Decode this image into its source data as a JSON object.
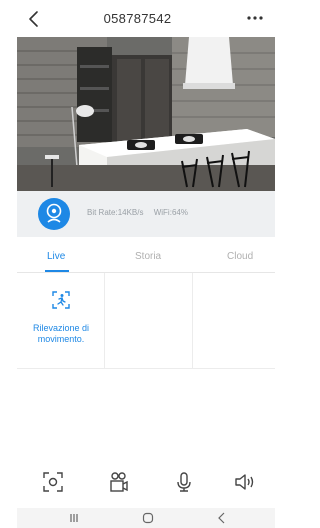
{
  "header": {
    "title": "058787542",
    "back_icon": "chevron-left-icon",
    "more_icon": "more-horizontal-icon"
  },
  "video": {
    "description_icon": "camera-feed"
  },
  "status": {
    "bitrate_label": "Bit Rate:",
    "bitrate_value": "14KB/s",
    "wifi_label": "WiFi:",
    "wifi_value": "64%",
    "camera_color": "#1e88e5"
  },
  "tabs": [
    {
      "label": "Live",
      "active": true
    },
    {
      "label": "Storia",
      "active": false
    },
    {
      "label": "Cloud",
      "active": false
    }
  ],
  "features": [
    {
      "label": "Rilevazione di movimento.",
      "icon": "motion-detection-icon"
    }
  ],
  "toolbar": [
    {
      "icon": "screenshot-icon"
    },
    {
      "icon": "video-record-icon"
    },
    {
      "icon": "microphone-icon"
    },
    {
      "icon": "speaker-icon"
    }
  ],
  "system_nav": [
    {
      "icon": "recent-apps-icon"
    },
    {
      "icon": "home-icon"
    },
    {
      "icon": "back-icon"
    }
  ],
  "colors": {
    "accent": "#1e88e5",
    "inactive": "#b0b0b0"
  }
}
